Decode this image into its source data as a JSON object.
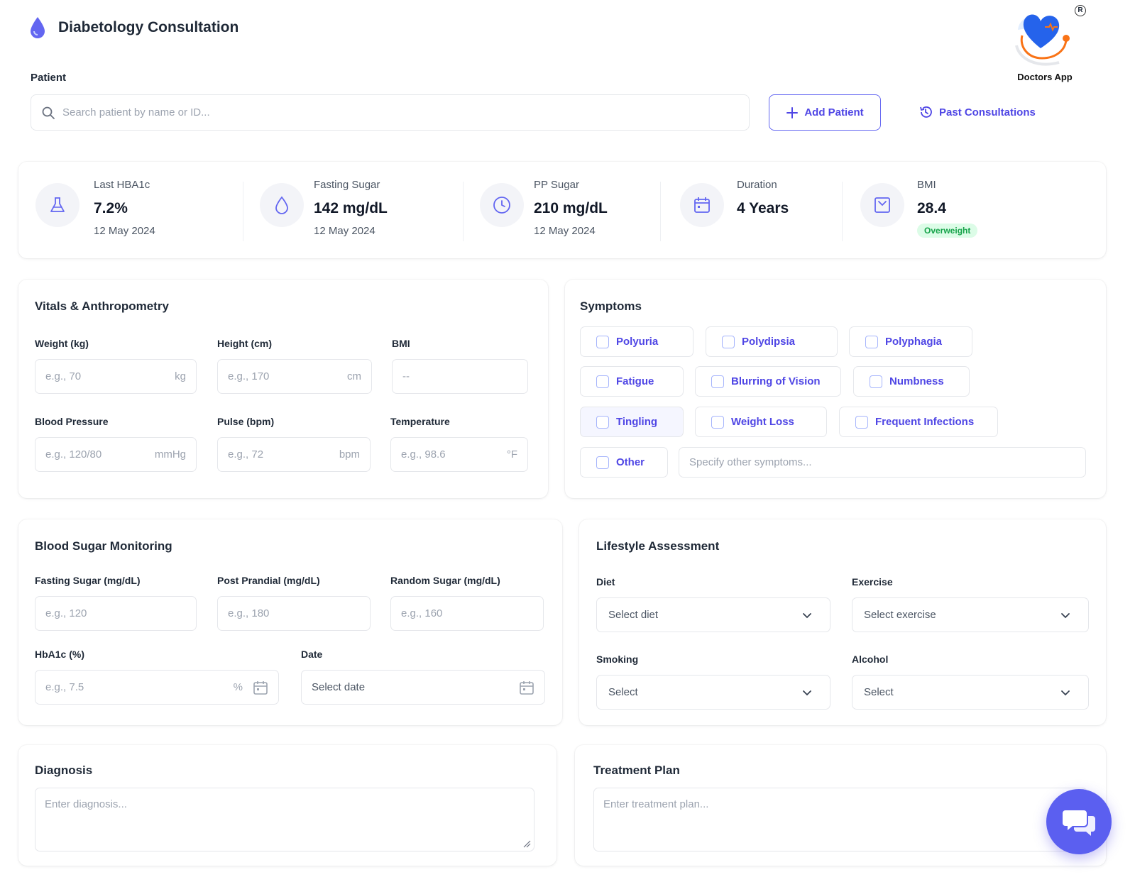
{
  "header": {
    "title": "Diabetology Consultation"
  },
  "brand": {
    "name": "Doctors App",
    "registered": "R"
  },
  "patient": {
    "label": "Patient",
    "search_placeholder": "Search patient by name or ID...",
    "add_button": "Add Patient",
    "past_link": "Past Consultations"
  },
  "stats": [
    {
      "title": "Last HBA1c",
      "value": "7.2%",
      "date": "12 May 2024",
      "icon": "flask-icon"
    },
    {
      "title": "Fasting Sugar",
      "value": "142 mg/dL",
      "date": "12 May 2024",
      "icon": "drop-icon"
    },
    {
      "title": "PP Sugar",
      "value": "210 mg/dL",
      "date": "12 May 2024",
      "icon": "clock-icon"
    },
    {
      "title": "Duration",
      "value": "4 Years",
      "icon": "calendar-icon"
    },
    {
      "title": "BMI",
      "value": "28.4",
      "badge": "Overweight",
      "icon": "scale-icon"
    }
  ],
  "vitals": {
    "title": "Vitals & Anthropometry",
    "weight": {
      "label": "Weight (kg)",
      "placeholder": "e.g., 70",
      "unit": "kg"
    },
    "height": {
      "label": "Height (cm)",
      "placeholder": "e.g., 170",
      "unit": "cm"
    },
    "bmi": {
      "label": "BMI",
      "placeholder": "--"
    },
    "bp": {
      "label": "Blood Pressure",
      "placeholder": "e.g., 120/80",
      "unit": "mmHg"
    },
    "pulse": {
      "label": "Pulse (bpm)",
      "placeholder": "e.g., 72",
      "unit": "bpm"
    },
    "temp": {
      "label": "Temperature",
      "placeholder": "e.g., 98.6",
      "unit": "°F"
    }
  },
  "symptoms": {
    "title": "Symptoms",
    "items": [
      "Polyuria",
      "Polydipsia",
      "Polyphagia",
      "Fatigue",
      "Blurring of Vision",
      "Numbness",
      "Tingling",
      "Weight Loss",
      "Frequent Infections",
      "Other"
    ],
    "other_placeholder": "Specify other symptoms..."
  },
  "sugar": {
    "title": "Blood Sugar Monitoring",
    "fasting": {
      "label": "Fasting Sugar (mg/dL)",
      "placeholder": "e.g., 120"
    },
    "pp": {
      "label": "Post Prandial (mg/dL)",
      "placeholder": "e.g., 180"
    },
    "random": {
      "label": "Random Sugar (mg/dL)",
      "placeholder": "e.g., 160"
    },
    "hba1c": {
      "label": "HbA1c (%)",
      "placeholder": "e.g., 7.5",
      "unit": "%"
    },
    "date": {
      "label": "Date",
      "placeholder": "Select date"
    }
  },
  "lifestyle": {
    "title": "Lifestyle Assessment",
    "diet": {
      "label": "Diet",
      "value": "Select diet"
    },
    "exercise": {
      "label": "Exercise",
      "value": "Select exercise"
    },
    "smoking": {
      "label": "Smoking",
      "value": "Select"
    },
    "alcohol": {
      "label": "Alcohol",
      "value": "Select"
    }
  },
  "diagnosis": {
    "title": "Diagnosis",
    "placeholder": "Enter diagnosis..."
  },
  "treatment": {
    "title": "Treatment Plan",
    "placeholder": "Enter treatment plan..."
  },
  "colors": {
    "accent": "#4f46e5",
    "badge_green": "#16a34a",
    "fab": "#5b5ff0"
  }
}
